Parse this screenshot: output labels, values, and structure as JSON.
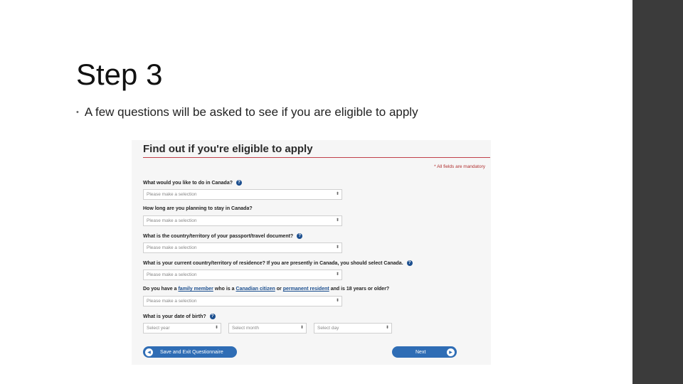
{
  "slide": {
    "title": "Step 3",
    "bullet": "A few questions will be asked to see if you are eligible to apply"
  },
  "form": {
    "heading": "Find out if you're eligible to apply",
    "mandatory_note": "* All fields are mandatory",
    "q1": {
      "label": "What would you like to do in Canada?",
      "placeholder": "Please make a selection"
    },
    "q2": {
      "label": "How long are you planning to stay in Canada?",
      "placeholder": "Please make a selection"
    },
    "q3": {
      "label": "What is the country/territory of your passport/travel document?",
      "placeholder": "Please make a selection"
    },
    "q4": {
      "label": "What is your current country/territory of residence? If you are presently in Canada, you should select Canada.",
      "placeholder": "Please make a selection"
    },
    "q5": {
      "pre": "Do you have a",
      "link1": "family member",
      "mid1": "who is a",
      "link2": "Canadian citizen",
      "mid2": "or",
      "link3": "permanent resident",
      "post": "and is 18 years or older?",
      "placeholder": "Please make a selection"
    },
    "q6": {
      "label": "What is your date of birth?",
      "year": "Select year",
      "month": "Select month",
      "day": "Select day"
    },
    "save_exit": "Save and Exit Questionnaire",
    "next": "Next"
  },
  "icons": {
    "help": "help-question-icon",
    "back": "left-arrow-icon",
    "next": "right-arrow-icon"
  },
  "colors": {
    "accent_blue": "#2f6db5",
    "rule_red": "#c0404a",
    "sidebar": "#3b3b3b"
  }
}
